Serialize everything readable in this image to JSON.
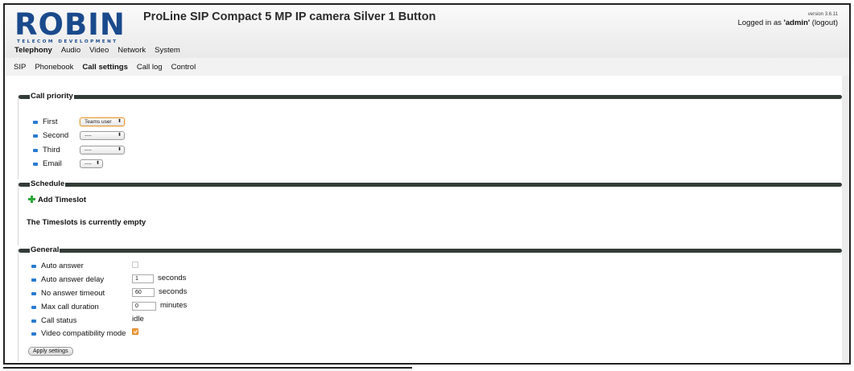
{
  "header": {
    "logo_text": "ROBIN",
    "logo_subtext": "TELECOM DEVELOPMENT",
    "title": "ProLine SIP Compact 5 MP IP camera Silver 1 Button",
    "version": "version 3.6.11",
    "login_prefix": "Logged in as ",
    "username": "'admin'",
    "logout": "(logout)"
  },
  "main_nav": [
    {
      "label": "Telephony",
      "active": true
    },
    {
      "label": "Audio"
    },
    {
      "label": "Video"
    },
    {
      "label": "Network"
    },
    {
      "label": "System"
    }
  ],
  "sub_nav": [
    {
      "label": "SIP"
    },
    {
      "label": "Phonebook"
    },
    {
      "label": "Call settings",
      "active": true
    },
    {
      "label": "Call log"
    },
    {
      "label": "Control"
    }
  ],
  "call_priority": {
    "legend": "Call priority",
    "rows": [
      {
        "label": "First",
        "value": "Teams user"
      },
      {
        "label": "Second",
        "value": "----"
      },
      {
        "label": "Third",
        "value": "----"
      },
      {
        "label": "Email",
        "value": "----"
      }
    ]
  },
  "schedule": {
    "legend": "Schedule",
    "add_label": "Add Timeslot",
    "empty_text": "The Timeslots is currently empty"
  },
  "general": {
    "legend": "General",
    "auto_answer": {
      "label": "Auto answer",
      "checked": false
    },
    "auto_answer_delay": {
      "label": "Auto answer delay",
      "value": "1",
      "unit": "seconds"
    },
    "no_answer_timeout": {
      "label": "No answer timeout",
      "value": "60",
      "unit": "seconds"
    },
    "max_call_duration": {
      "label": "Max call duration",
      "value": "0",
      "unit": "minutes"
    },
    "call_status": {
      "label": "Call status",
      "value": "idle"
    },
    "video_compat": {
      "label": "Video compatibility mode",
      "checked": true
    },
    "apply_label": "Apply settings"
  },
  "colors": {
    "logo_blue": "#1a4a8c",
    "bullet_blue": "#2a7bd0",
    "legend_bar": "#333c37",
    "checkbox_orange": "#f29e3b",
    "add_green": "#2ca83a"
  }
}
